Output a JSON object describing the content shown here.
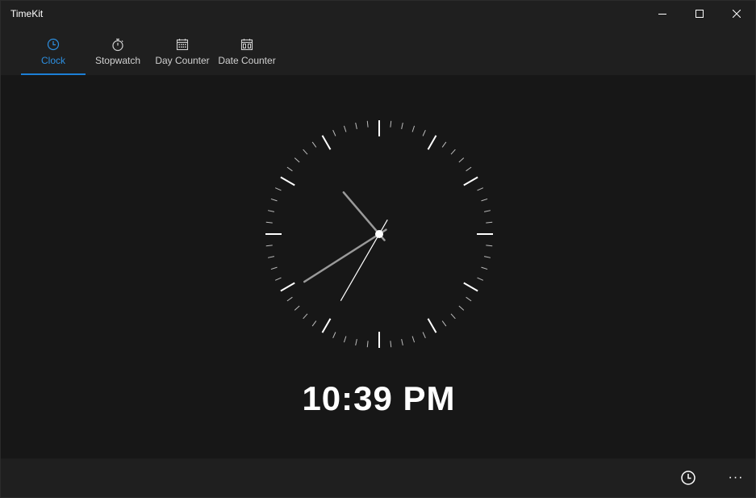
{
  "window": {
    "title": "TimeKit"
  },
  "tabs": [
    {
      "label": "Clock",
      "icon": "clock-icon",
      "active": true
    },
    {
      "label": "Stopwatch",
      "icon": "stopwatch-icon",
      "active": false
    },
    {
      "label": "Day Counter",
      "icon": "calendar-icon",
      "active": false
    },
    {
      "label": "Date Counter",
      "icon": "calendar-grid-icon",
      "active": false
    }
  ],
  "clock": {
    "digital_time": "10:39 PM",
    "hour": 10,
    "minute": 39,
    "second": 35
  },
  "bottom_bar": {
    "alarm_icon": "clock-icon",
    "more_label": "···"
  },
  "colors": {
    "accent": "#1c7fd6",
    "background": "#171717",
    "chrome": "#1f1f1f"
  }
}
